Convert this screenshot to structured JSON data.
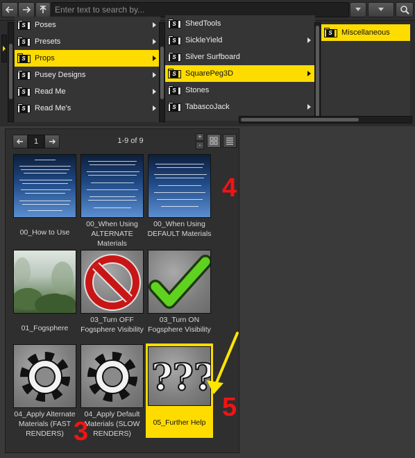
{
  "search": {
    "placeholder": "Enter text to search by..."
  },
  "browser": {
    "column1": [
      {
        "label": "Poses",
        "selected": false
      },
      {
        "label": "Presets",
        "selected": false
      },
      {
        "label": "Props",
        "selected": true
      },
      {
        "label": "Pusey Designs",
        "selected": false
      },
      {
        "label": "Read Me",
        "selected": false
      },
      {
        "label": "Read Me's",
        "selected": false
      }
    ],
    "column2": [
      {
        "label": "ShedTools",
        "selected": false
      },
      {
        "label": "SickleYield",
        "selected": false
      },
      {
        "label": "Silver Surfboard",
        "selected": false
      },
      {
        "label": "SquarePeg3D",
        "selected": true
      },
      {
        "label": "Stones",
        "selected": false
      },
      {
        "label": "TabascoJack",
        "selected": false
      }
    ],
    "column3": [
      {
        "label": "Miscellaneous",
        "selected": true
      }
    ]
  },
  "content": {
    "page": "1",
    "counter": "1-9 of 9",
    "zoom_in": "+",
    "zoom_out": "-",
    "items": [
      {
        "caption": "00_How to Use",
        "thumb": "document"
      },
      {
        "caption": "00_When Using ALTERNATE Materials",
        "thumb": "document"
      },
      {
        "caption": "00_When Using DEFAULT Materials",
        "thumb": "document"
      },
      {
        "caption": "01_Fogsphere",
        "thumb": "fog-photo"
      },
      {
        "caption": "03_Turn OFF Fogsphere Visibility",
        "thumb": "prohibited-sign"
      },
      {
        "caption": "03_Turn ON Fogsphere Visibility",
        "thumb": "check-mark"
      },
      {
        "caption": "04_Apply Alternate Materials (FAST RENDERS)",
        "thumb": "gear"
      },
      {
        "caption": "04_Apply Default Materials (SLOW RENDERS)",
        "thumb": "gear"
      },
      {
        "caption": "05_Further Help",
        "thumb": "question-marks",
        "selected": true
      }
    ]
  },
  "annotations": {
    "n3": "3",
    "n4": "4",
    "n5": "5"
  },
  "colors": {
    "highlight": "#ffdc00",
    "annotation": "#f01414",
    "arrow": "#ffe600"
  }
}
